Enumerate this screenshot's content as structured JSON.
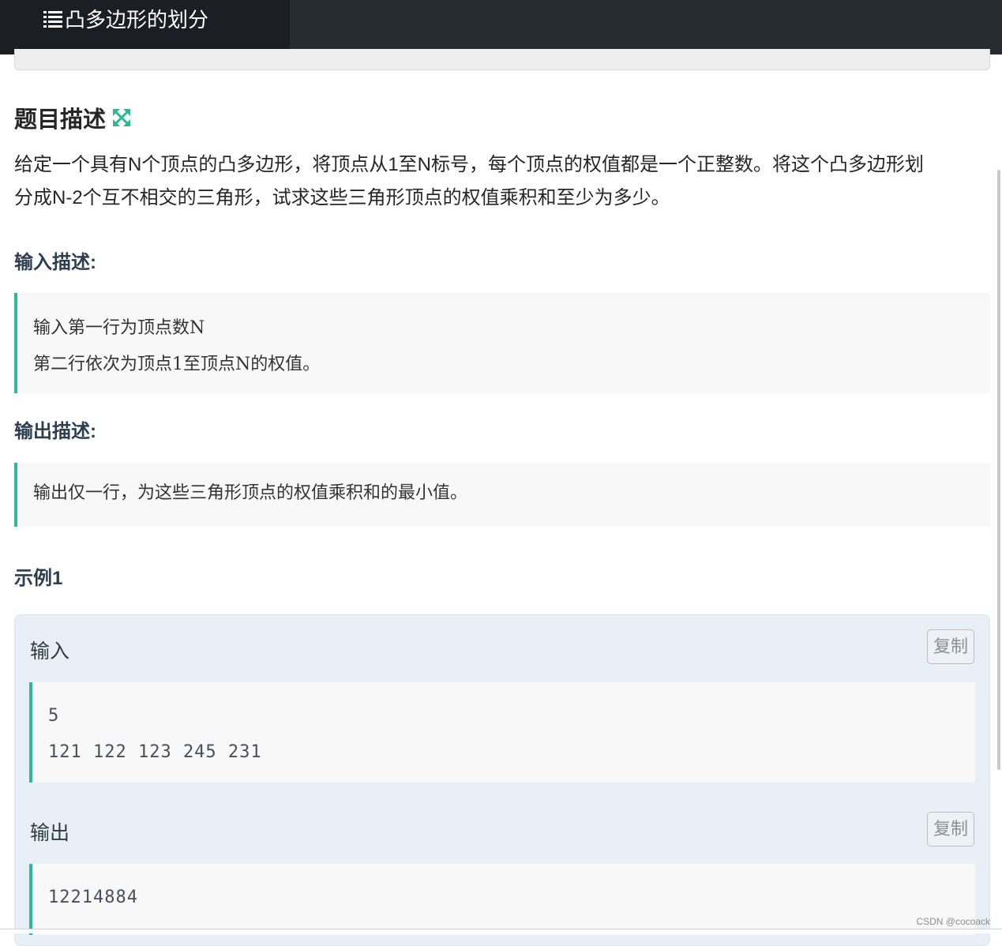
{
  "header": {
    "title": "凸多边形的划分",
    "icon": "list-icon"
  },
  "problem": {
    "section_title": "题目描述",
    "expand_icon": "expand-icon",
    "description_line1": "给定一个具有N个顶点的凸多边形，将顶点从1至N标号，每个顶点的权值都是一个正整数。将这个凸多边形划",
    "description_line2": "分成N-2个互不相交的三角形，试求这些三角形顶点的权值乘积和至少为多少。",
    "input_title": "输入描述:",
    "input_line1": "输入第一行为顶点数N",
    "input_line2": "第二行依次为顶点1至顶点N的权值。",
    "output_title": "输出描述:",
    "output_line1": "输出仅一行，为这些三角形顶点的权值乘积和的最小值。"
  },
  "example": {
    "title": "示例1",
    "input_label": "输入",
    "input_line1": "5",
    "input_line2": "121 122 123 245 231",
    "output_label": "输出",
    "output_line1": "12214884",
    "copy_label": "复制"
  },
  "watermark": "CSDN @cocoack",
  "colors": {
    "accent": "#2fb895",
    "topbar": "#262b31"
  }
}
